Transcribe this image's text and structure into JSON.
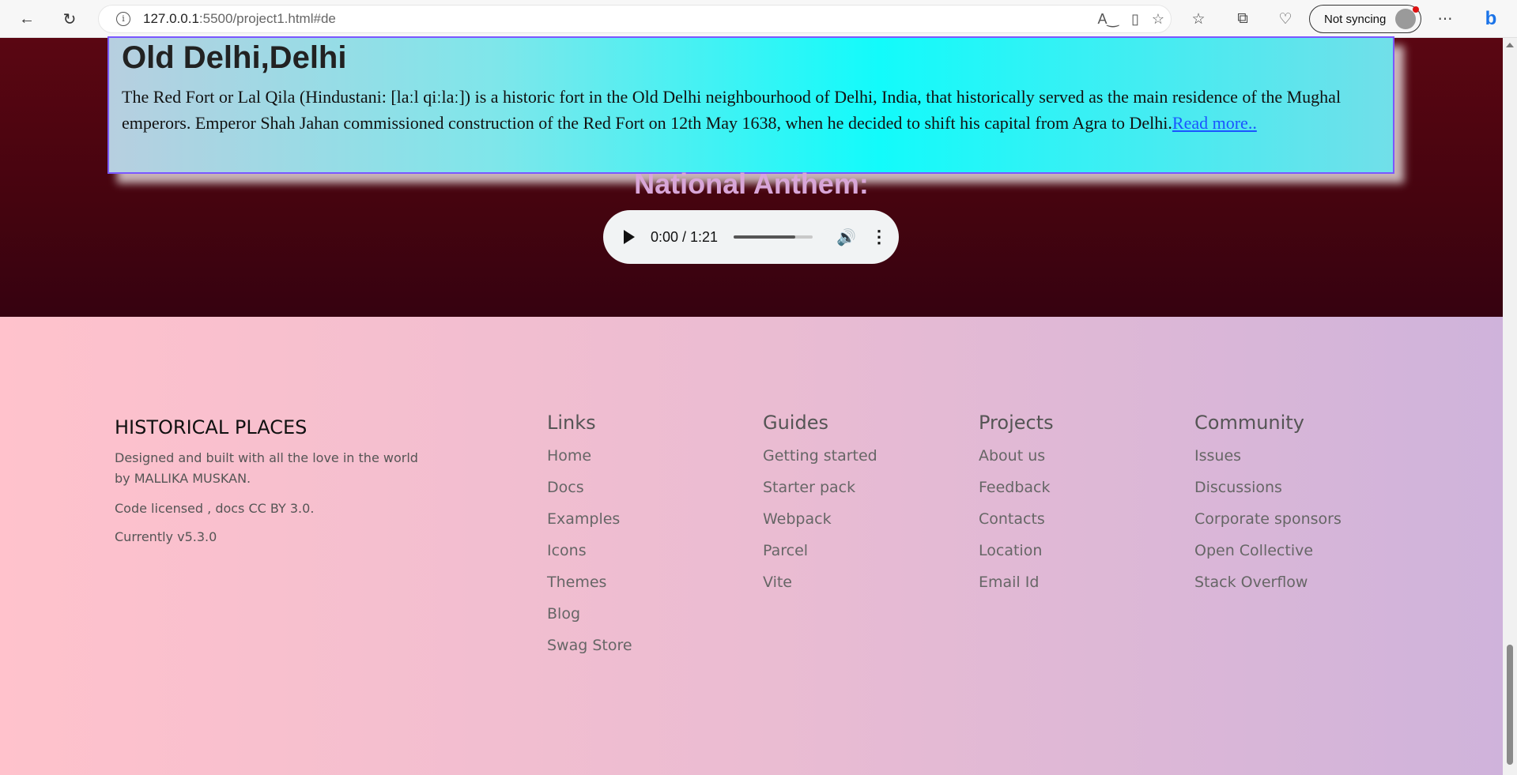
{
  "browser": {
    "url_host": "127.0.0.1",
    "url_rest": ":5500/project1.html#de",
    "sync_label": "Not syncing"
  },
  "card": {
    "title": "Old Delhi,Delhi",
    "text": "The Red Fort or Lal Qila (Hindustani: [laːl qiːlaː]) is a historic fort in the Old Delhi neighbourhood of Delhi, India, that historically served as the main residence of the Mughal emperors. Emperor Shah Jahan commissioned construction of the Red Fort on 12th May 1638, when he decided to shift his capital from Agra to Delhi.",
    "read_more": "Read more.."
  },
  "anthem": {
    "title": "National Anthem:",
    "time": "0:00 / 1:21",
    "progress_fraction": 0.78
  },
  "footer": {
    "brand": "HISTORICAL PLACES",
    "tagline": "Designed and built with all the love in the world by MALLIKA MUSKAN.",
    "license": "Code licensed , docs CC BY 3.0.",
    "version": "Currently v5.3.0",
    "columns": [
      {
        "title": "Links",
        "items": [
          "Home",
          "Docs",
          "Examples",
          "Icons",
          "Themes",
          "Blog",
          "Swag Store"
        ]
      },
      {
        "title": "Guides",
        "items": [
          "Getting started",
          "Starter pack",
          "Webpack",
          "Parcel",
          "Vite"
        ]
      },
      {
        "title": "Projects",
        "items": [
          "About us",
          "Feedback",
          "Contacts",
          "Location",
          "Email Id"
        ]
      },
      {
        "title": "Community",
        "items": [
          "Issues",
          "Discussions",
          "Corporate sponsors",
          "Open Collective",
          "Stack Overflow"
        ]
      }
    ]
  },
  "colors": {
    "hero_top": "#5a0612",
    "card_border": "#7a57ff",
    "anthem_title": "#d8a6d8",
    "link": "#1a55ff"
  }
}
